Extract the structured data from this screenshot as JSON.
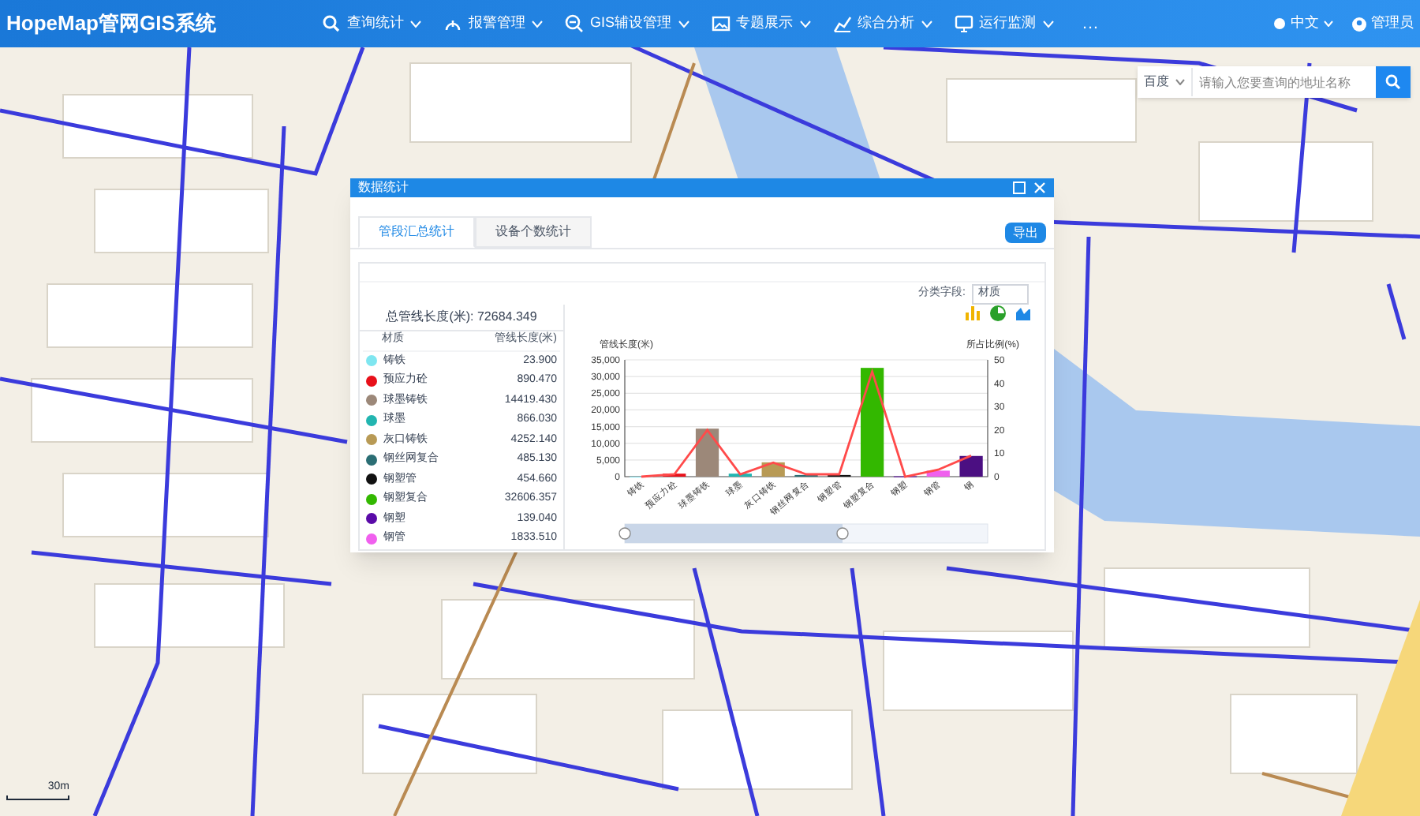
{
  "top_bar": {
    "logo": "HopeMap管网GIS系统",
    "menu": [
      {
        "label": "查询统计"
      },
      {
        "label": "报警管理"
      },
      {
        "label": "GIS辅设管理"
      },
      {
        "label": "专题展示"
      },
      {
        "label": "综合分析"
      },
      {
        "label": "运行监测"
      }
    ],
    "more": "…",
    "language": "中文",
    "user": "管理员"
  },
  "search": {
    "source": "百度",
    "placeholder": "请输入您要查询的地址名称"
  },
  "dialog": {
    "title": "数据统计",
    "tabs": [
      {
        "label": "管段汇总统计",
        "selected": true
      },
      {
        "label": "设备个数统计",
        "selected": false
      }
    ],
    "export_button": "导出",
    "field_label": "分类字段:",
    "field_value": "材质",
    "total": "总管线长度(米): 72684.349",
    "table": {
      "columns": [
        "材质",
        "管线长度(米)"
      ],
      "rows": [
        {
          "material": "铸铁",
          "length": "23.900",
          "color": "#7fe6f0"
        },
        {
          "material": "预应力砼",
          "length": "890.470",
          "color": "#e8101a"
        },
        {
          "material": "球墨铸铁",
          "length": "14419.430",
          "color": "#9c8879"
        },
        {
          "material": "球墨",
          "length": "866.030",
          "color": "#22b5b0"
        },
        {
          "material": "灰口铸铁",
          "length": "4252.140",
          "color": "#b89a55"
        },
        {
          "material": "钢丝网复合",
          "length": "485.130",
          "color": "#2b6e74"
        },
        {
          "material": "钢塑管",
          "length": "454.660",
          "color": "#111111"
        },
        {
          "material": "钢塑复合",
          "length": "32606.357",
          "color": "#33b800"
        },
        {
          "material": "钢塑",
          "length": "139.040",
          "color": "#5a0aa8"
        },
        {
          "material": "钢管",
          "length": "1833.510",
          "color": "#f060ee"
        }
      ]
    },
    "chart_data": {
      "type": "bar",
      "ylabel": "管线长度(米)",
      "y2label": "所占比例(%)",
      "categories": [
        "铸铁",
        "预应力砼",
        "球墨铸铁",
        "球墨",
        "灰口铸铁",
        "钢丝网复合",
        "钢塑管",
        "钢塑复合",
        "钢塑",
        "钢管",
        "钢"
      ],
      "series": [
        {
          "colors": [
            "#7fe6f0",
            "#e8101a",
            "#9c8879",
            "#22b5b0",
            "#b89a55",
            "#2b6e74",
            "#111111",
            "#33b800",
            "#5a0aa8",
            "#f060ee",
            "#4b0f82"
          ],
          "values": [
            0,
            900,
            14400,
            900,
            4300,
            500,
            500,
            32600,
            100,
            1800,
            6200
          ]
        },
        {
          "type": "line",
          "axis": "y2",
          "color": "#ff4a4a",
          "values": [
            0,
            1,
            20,
            1,
            6,
            1,
            1,
            45,
            0,
            3,
            9
          ]
        }
      ],
      "grid": true,
      "ylim": [
        0,
        35000
      ],
      "yticks": [
        0,
        {
          "value": 5000,
          "label": "5,000"
        },
        {
          "value": 10000,
          "label": "10,000"
        },
        {
          "value": 15000,
          "label": "15,000"
        },
        {
          "value": 20000,
          "label": "20,000"
        },
        {
          "value": 25000,
          "label": "25,000"
        },
        {
          "value": 30000,
          "label": "30,000"
        },
        {
          "value": 35000,
          "label": "35,000"
        }
      ],
      "y2lim": [
        0,
        50
      ],
      "y2ticks": [
        0,
        10,
        20,
        30,
        40,
        50
      ]
    }
  },
  "scale": {
    "label": "30m"
  }
}
